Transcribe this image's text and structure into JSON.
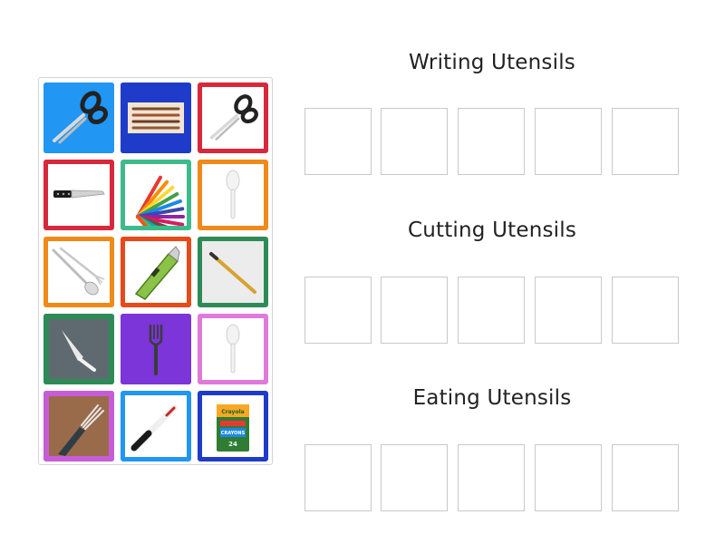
{
  "tray": {
    "tiles": [
      {
        "icon": "scissors-icon",
        "frame": "#2196f3",
        "style": "filled"
      },
      {
        "icon": "pens-icon",
        "frame": "#1f3bc9",
        "style": "filled"
      },
      {
        "icon": "scissors-icon",
        "frame": "#d8283b",
        "style": "bordered"
      },
      {
        "icon": "knife-icon",
        "frame": "#d8283b",
        "style": "bordered"
      },
      {
        "icon": "colored-pencils-icon",
        "frame": "#3dbb8d",
        "style": "bordered"
      },
      {
        "icon": "spoon-icon",
        "frame": "#f08a1a",
        "style": "bordered"
      },
      {
        "icon": "fork-and-spoon-icon",
        "frame": "#f08a1a",
        "style": "bordered"
      },
      {
        "icon": "green-utility-knife-icon",
        "frame": "#e64a19",
        "style": "bordered"
      },
      {
        "icon": "pencil-icon",
        "frame": "#2e8b57",
        "style": "bordered"
      },
      {
        "icon": "butter-knife-icon",
        "frame": "#2e8b57",
        "style": "filled"
      },
      {
        "icon": "fork-icon",
        "frame": "#7b35d9",
        "style": "filled"
      },
      {
        "icon": "spoon-icon",
        "frame": "#e07ad9",
        "style": "bordered"
      },
      {
        "icon": "fork-photo-icon",
        "frame": "#c65cd6",
        "style": "filled"
      },
      {
        "icon": "pen-icon",
        "frame": "#2196f3",
        "style": "bordered"
      },
      {
        "icon": "crayons-box-icon",
        "frame": "#1f3bc9",
        "style": "bordered"
      }
    ]
  },
  "groups": [
    {
      "title": "Writing Utensils"
    },
    {
      "title": "Cutting Utensils"
    },
    {
      "title": "Eating Utensils"
    }
  ],
  "crayons_box": {
    "brand": "Crayola",
    "label": "CRAYONS",
    "count": "24"
  }
}
